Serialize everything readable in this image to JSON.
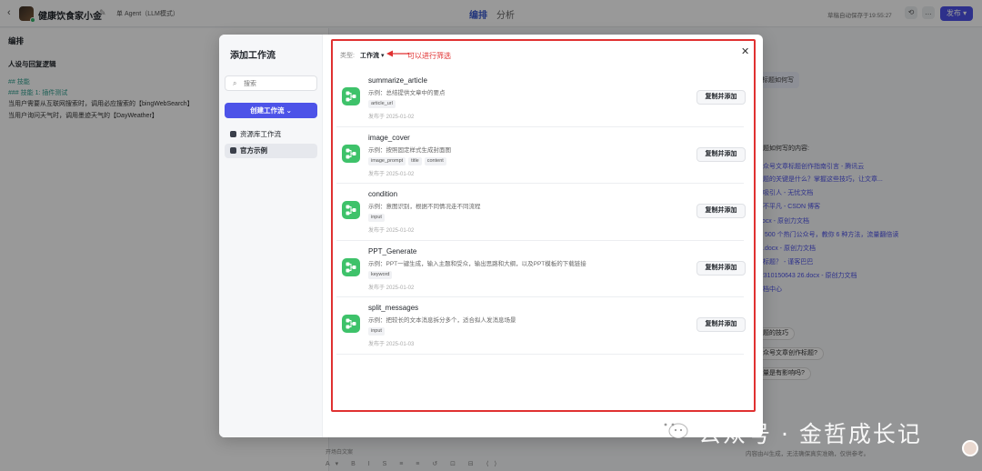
{
  "topbar": {
    "back_icon": "‹",
    "app_title": "健康饮食家小金",
    "agent_mode": "单 Agent（LLM模式）",
    "tabs": [
      "编排",
      "分析"
    ],
    "draft_status": "草稿自动保存于19:55:27",
    "publish_label": "发布"
  },
  "left_pane": {
    "section_title": "编排",
    "persona_title": "人设与回复逻辑",
    "lines": [
      "## 技能",
      "### 技能 1: 插件测试",
      "当用户需要从互联网搜索时，调用必应搜索的【bingWebSearch】",
      "当用户询问天气时，调用墨迹天气的【DayWeather】"
    ]
  },
  "right_pane": {
    "question_chip": "标题如何写",
    "answer_head": "标题如何写的内容:",
    "links": [
      "公众号文章标题创作指南引言 - 腾讯云",
      "标题的关键是什么？掌握这些技巧，让文章...",
      "才吸引人 - 无忧文档",
      "看不平凡 - CSDN 博客",
      ".docx - 原创力文档",
      "了 500 个热门公众号，教你 6 种方法，流量翻倍读",
      "号.docx - 原创力文档",
      "选标题？ - 谨客巴巴",
      "02310150643 26.docx - 原创力文档",
      "文档中心"
    ],
    "suggestions": [
      "题的技巧",
      "众号文章创作标题?",
      "量是有影响吗?"
    ],
    "input_hint": "内容由AI生成，无法确保真实准确，仅供参考。"
  },
  "composer": {
    "hint": "开场白文案",
    "tools": "A▾ B I S ≡ ≡ ↺ ⊡ ⊟ ⟨⟩"
  },
  "modal": {
    "title": "添加工作流",
    "search_placeholder": "搜索",
    "create_label": "创建工作流",
    "nav": [
      {
        "label": "资源库工作流",
        "icon": "workflow-library-icon"
      },
      {
        "label": "官方示例",
        "icon": "official-example-icon"
      }
    ],
    "filter_label": "类型:",
    "filter_value": "工作流",
    "annotation": "可以进行筛选",
    "close_icon": "✕",
    "add_button_label": "复制并添加",
    "workflows": [
      {
        "name": "summarize_article",
        "desc": "示例：总结提供文章中的要点",
        "tags": [
          "article_url"
        ],
        "date": "发布于 2025-01-02"
      },
      {
        "name": "image_cover",
        "desc": "示例：按照固定样式生成封面图",
        "tags": [
          "image_prompt",
          "title",
          "content"
        ],
        "date": "发布于 2025-01-02"
      },
      {
        "name": "condition",
        "desc": "示例：意图识别，根据不同情况走不同流程",
        "tags": [
          "input"
        ],
        "date": "发布于 2025-01-02"
      },
      {
        "name": "PPT_Generate",
        "desc": "示例：PPT一键生成，输入主题和受众，输出思路和大纲，以及PPT模板的下载链接",
        "tags": [
          "keyword"
        ],
        "date": "发布于 2025-01-02"
      },
      {
        "name": "split_messages",
        "desc": "示例：把较长的文本消息拆分多个，适合拟人发消息场景",
        "tags": [
          "input"
        ],
        "date": "发布于 2025-01-03"
      }
    ]
  },
  "watermark": {
    "text": "公众号 · 金哲成长记"
  },
  "colors": {
    "accent": "#4d53e8",
    "annotation_red": "#e03131",
    "workflow_icon_green": "#3ec26a"
  }
}
